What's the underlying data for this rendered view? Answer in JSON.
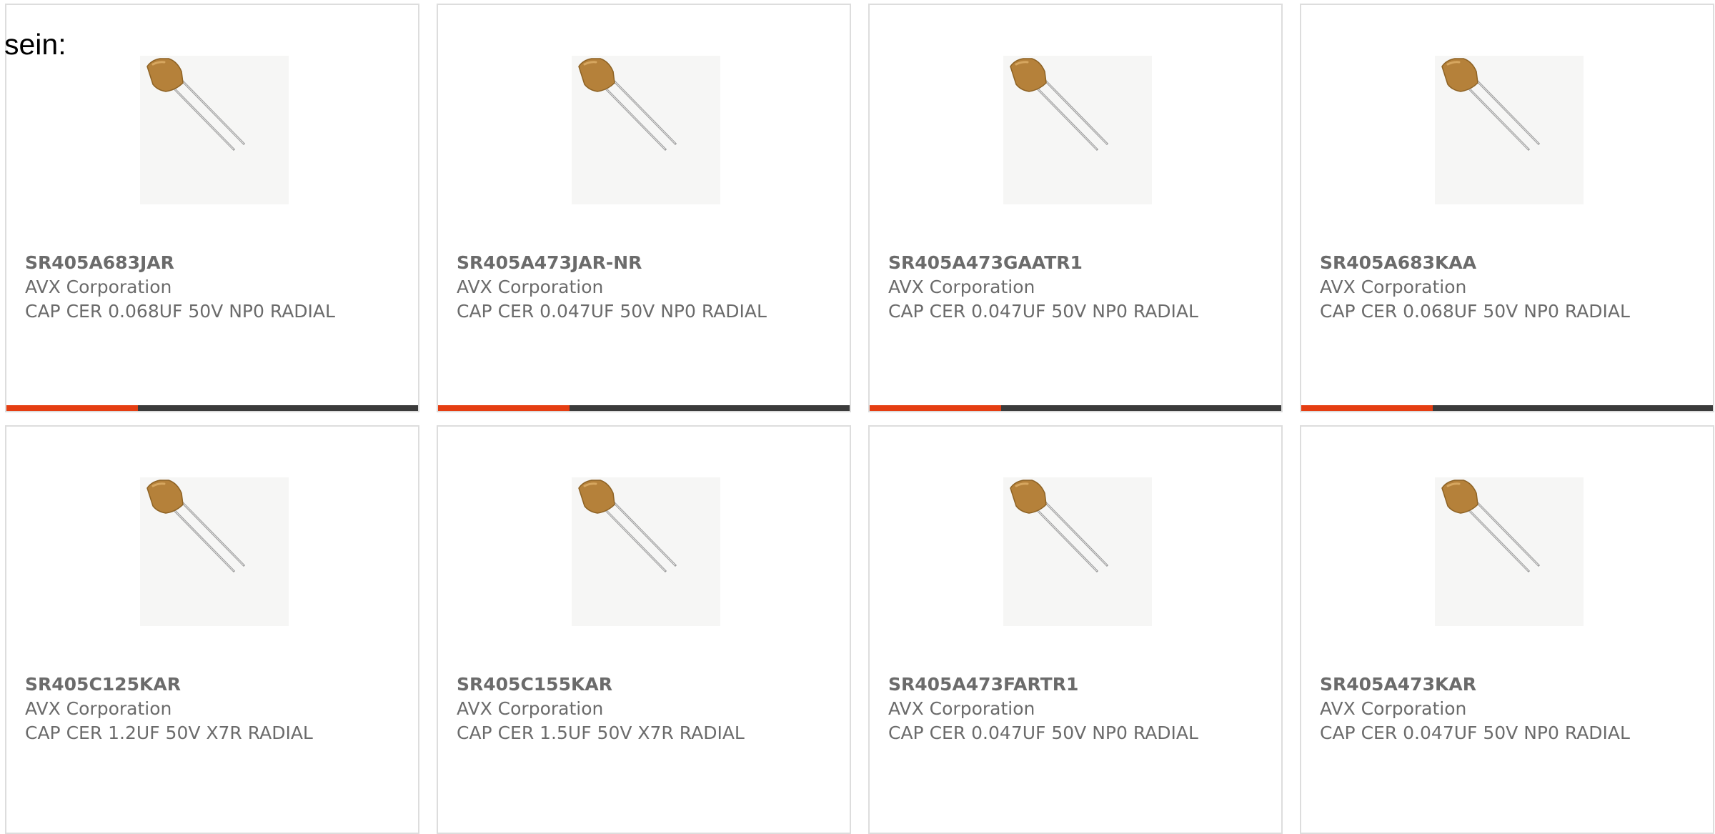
{
  "intro_text": "sein:",
  "colors": {
    "accent": "#e53e12",
    "bar": "#3b3b3b",
    "text": "#6b6b6b",
    "border": "#dddddd",
    "capacitor_body": "#b5813a"
  },
  "products": [
    {
      "part_number": "SR405A683JAR",
      "manufacturer": "AVX Corporation",
      "description": "CAP CER 0.068UF 50V NP0 RADIAL",
      "image_icon": "radial-ceramic-capacitor-icon"
    },
    {
      "part_number": "SR405A473JAR-NR",
      "manufacturer": "AVX Corporation",
      "description": "CAP CER 0.047UF 50V NP0 RADIAL",
      "image_icon": "radial-ceramic-capacitor-icon"
    },
    {
      "part_number": "SR405A473GAATR1",
      "manufacturer": "AVX Corporation",
      "description": "CAP CER 0.047UF 50V NP0 RADIAL",
      "image_icon": "radial-ceramic-capacitor-icon"
    },
    {
      "part_number": "SR405A683KAA",
      "manufacturer": "AVX Corporation",
      "description": "CAP CER 0.068UF 50V NP0 RADIAL",
      "image_icon": "radial-ceramic-capacitor-icon"
    },
    {
      "part_number": "SR405C125KAR",
      "manufacturer": "AVX Corporation",
      "description": "CAP CER 1.2UF 50V X7R RADIAL",
      "image_icon": "radial-ceramic-capacitor-icon"
    },
    {
      "part_number": "SR405C155KAR",
      "manufacturer": "AVX Corporation",
      "description": "CAP CER 1.5UF 50V X7R RADIAL",
      "image_icon": "radial-ceramic-capacitor-icon"
    },
    {
      "part_number": "SR405A473FARTR1",
      "manufacturer": "AVX Corporation",
      "description": "CAP CER 0.047UF 50V NP0 RADIAL",
      "image_icon": "radial-ceramic-capacitor-icon"
    },
    {
      "part_number": "SR405A473KAR",
      "manufacturer": "AVX Corporation",
      "description": "CAP CER 0.047UF 50V NP0 RADIAL",
      "image_icon": "radial-ceramic-capacitor-icon"
    }
  ]
}
